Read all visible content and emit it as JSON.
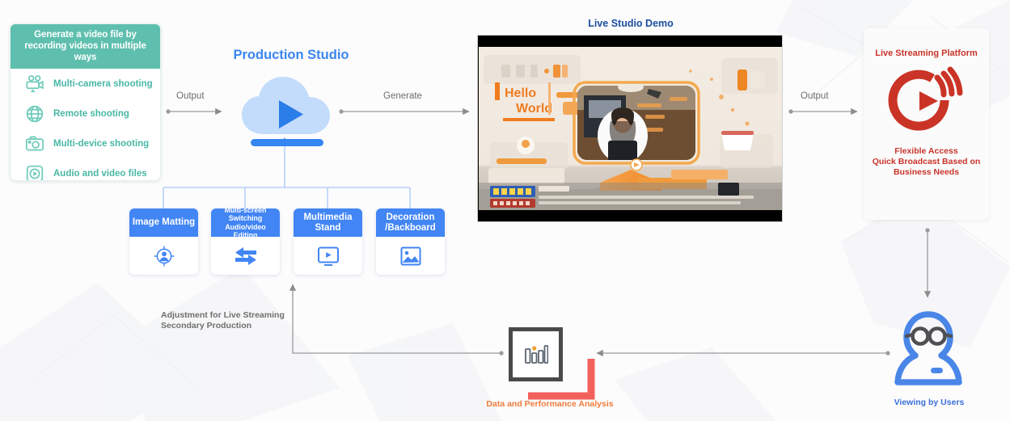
{
  "recording_card": {
    "header": "Generate a video file by recording videos in multiple ways",
    "items": [
      {
        "icon": "multi-camera-icon",
        "label": "Multi-camera shooting"
      },
      {
        "icon": "globe-remote-icon",
        "label": "Remote shooting"
      },
      {
        "icon": "camera-device-icon",
        "label": "Multi-device shooting"
      },
      {
        "icon": "media-file-icon",
        "label": "Audio and video files"
      }
    ]
  },
  "production_studio": {
    "title": "Production Studio",
    "icon": "cloud-play-icon",
    "features": [
      {
        "title": "Image Matting",
        "size": "big",
        "icon": "person-target-icon"
      },
      {
        "title": "Multi-screen Switching Audio/video Editing",
        "size": "small",
        "icon": "switch-arrows-icon"
      },
      {
        "title": "Multimedia Stand",
        "size": "big",
        "icon": "play-frame-icon"
      },
      {
        "title": "Decoration /Backboard",
        "size": "big",
        "icon": "image-picture-icon"
      }
    ]
  },
  "arrows": {
    "output_left": "Output",
    "generate": "Generate",
    "output_right": "Output"
  },
  "demo": {
    "title": "Live Studio Demo",
    "overlay_text_line1": "Hello",
    "overlay_text_line2": "World"
  },
  "platform": {
    "title": "Live Streaming Platform",
    "icon": "broadcast-play-icon",
    "subtitle": "Flexible Access\nQuick Broadcast Based on\nBusiness Needs",
    "subtitle_lines": [
      "Flexible Access",
      "Quick Broadcast Based on",
      "Business Needs"
    ]
  },
  "analysis": {
    "label": "Data and Performance Analysis",
    "icon": "bar-chart-icon"
  },
  "viewer": {
    "label": "Viewing by Users",
    "icon": "user-glasses-icon"
  },
  "adjustment": {
    "line1": "Adjustment for Live Streaming",
    "line2": "Secondary Production"
  },
  "colors": {
    "green": "#5fbfae",
    "green_text": "#49b7a5",
    "blue": "#4285f4",
    "blue_title": "#3a86f0",
    "navy": "#1c4fa0",
    "red": "#c9342a",
    "orange": "#ef7c3c",
    "gray_arrow": "#8c8c8c",
    "dark_frame": "#4a4a4a",
    "accent_red": "#f2605c"
  }
}
